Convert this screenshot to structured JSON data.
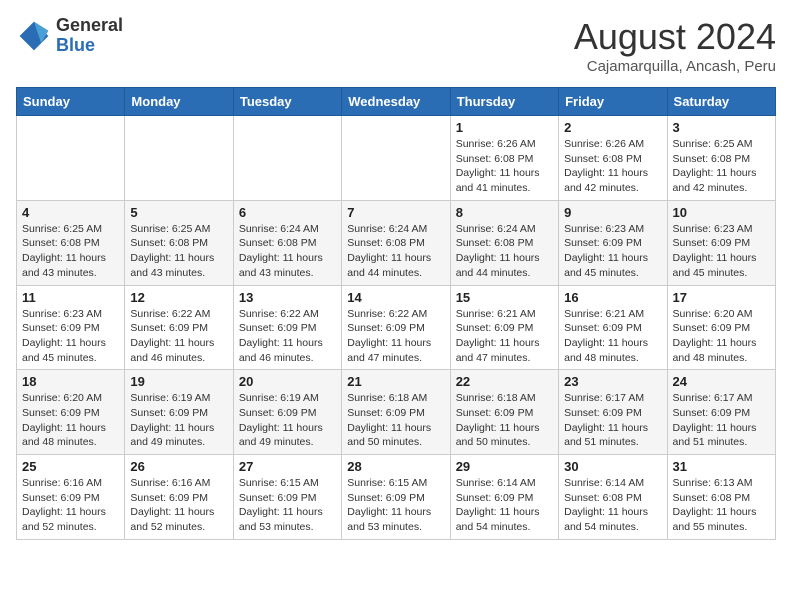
{
  "logo": {
    "general": "General",
    "blue": "Blue"
  },
  "header": {
    "month": "August 2024",
    "location": "Cajamarquilla, Ancash, Peru"
  },
  "weekdays": [
    "Sunday",
    "Monday",
    "Tuesday",
    "Wednesday",
    "Thursday",
    "Friday",
    "Saturday"
  ],
  "weeks": [
    [
      {
        "day": "",
        "info": ""
      },
      {
        "day": "",
        "info": ""
      },
      {
        "day": "",
        "info": ""
      },
      {
        "day": "",
        "info": ""
      },
      {
        "day": "1",
        "info": "Sunrise: 6:26 AM\nSunset: 6:08 PM\nDaylight: 11 hours and 41 minutes."
      },
      {
        "day": "2",
        "info": "Sunrise: 6:26 AM\nSunset: 6:08 PM\nDaylight: 11 hours and 42 minutes."
      },
      {
        "day": "3",
        "info": "Sunrise: 6:25 AM\nSunset: 6:08 PM\nDaylight: 11 hours and 42 minutes."
      }
    ],
    [
      {
        "day": "4",
        "info": "Sunrise: 6:25 AM\nSunset: 6:08 PM\nDaylight: 11 hours and 43 minutes."
      },
      {
        "day": "5",
        "info": "Sunrise: 6:25 AM\nSunset: 6:08 PM\nDaylight: 11 hours and 43 minutes."
      },
      {
        "day": "6",
        "info": "Sunrise: 6:24 AM\nSunset: 6:08 PM\nDaylight: 11 hours and 43 minutes."
      },
      {
        "day": "7",
        "info": "Sunrise: 6:24 AM\nSunset: 6:08 PM\nDaylight: 11 hours and 44 minutes."
      },
      {
        "day": "8",
        "info": "Sunrise: 6:24 AM\nSunset: 6:08 PM\nDaylight: 11 hours and 44 minutes."
      },
      {
        "day": "9",
        "info": "Sunrise: 6:23 AM\nSunset: 6:09 PM\nDaylight: 11 hours and 45 minutes."
      },
      {
        "day": "10",
        "info": "Sunrise: 6:23 AM\nSunset: 6:09 PM\nDaylight: 11 hours and 45 minutes."
      }
    ],
    [
      {
        "day": "11",
        "info": "Sunrise: 6:23 AM\nSunset: 6:09 PM\nDaylight: 11 hours and 45 minutes."
      },
      {
        "day": "12",
        "info": "Sunrise: 6:22 AM\nSunset: 6:09 PM\nDaylight: 11 hours and 46 minutes."
      },
      {
        "day": "13",
        "info": "Sunrise: 6:22 AM\nSunset: 6:09 PM\nDaylight: 11 hours and 46 minutes."
      },
      {
        "day": "14",
        "info": "Sunrise: 6:22 AM\nSunset: 6:09 PM\nDaylight: 11 hours and 47 minutes."
      },
      {
        "day": "15",
        "info": "Sunrise: 6:21 AM\nSunset: 6:09 PM\nDaylight: 11 hours and 47 minutes."
      },
      {
        "day": "16",
        "info": "Sunrise: 6:21 AM\nSunset: 6:09 PM\nDaylight: 11 hours and 48 minutes."
      },
      {
        "day": "17",
        "info": "Sunrise: 6:20 AM\nSunset: 6:09 PM\nDaylight: 11 hours and 48 minutes."
      }
    ],
    [
      {
        "day": "18",
        "info": "Sunrise: 6:20 AM\nSunset: 6:09 PM\nDaylight: 11 hours and 48 minutes."
      },
      {
        "day": "19",
        "info": "Sunrise: 6:19 AM\nSunset: 6:09 PM\nDaylight: 11 hours and 49 minutes."
      },
      {
        "day": "20",
        "info": "Sunrise: 6:19 AM\nSunset: 6:09 PM\nDaylight: 11 hours and 49 minutes."
      },
      {
        "day": "21",
        "info": "Sunrise: 6:18 AM\nSunset: 6:09 PM\nDaylight: 11 hours and 50 minutes."
      },
      {
        "day": "22",
        "info": "Sunrise: 6:18 AM\nSunset: 6:09 PM\nDaylight: 11 hours and 50 minutes."
      },
      {
        "day": "23",
        "info": "Sunrise: 6:17 AM\nSunset: 6:09 PM\nDaylight: 11 hours and 51 minutes."
      },
      {
        "day": "24",
        "info": "Sunrise: 6:17 AM\nSunset: 6:09 PM\nDaylight: 11 hours and 51 minutes."
      }
    ],
    [
      {
        "day": "25",
        "info": "Sunrise: 6:16 AM\nSunset: 6:09 PM\nDaylight: 11 hours and 52 minutes."
      },
      {
        "day": "26",
        "info": "Sunrise: 6:16 AM\nSunset: 6:09 PM\nDaylight: 11 hours and 52 minutes."
      },
      {
        "day": "27",
        "info": "Sunrise: 6:15 AM\nSunset: 6:09 PM\nDaylight: 11 hours and 53 minutes."
      },
      {
        "day": "28",
        "info": "Sunrise: 6:15 AM\nSunset: 6:09 PM\nDaylight: 11 hours and 53 minutes."
      },
      {
        "day": "29",
        "info": "Sunrise: 6:14 AM\nSunset: 6:09 PM\nDaylight: 11 hours and 54 minutes."
      },
      {
        "day": "30",
        "info": "Sunrise: 6:14 AM\nSunset: 6:08 PM\nDaylight: 11 hours and 54 minutes."
      },
      {
        "day": "31",
        "info": "Sunrise: 6:13 AM\nSunset: 6:08 PM\nDaylight: 11 hours and 55 minutes."
      }
    ]
  ]
}
